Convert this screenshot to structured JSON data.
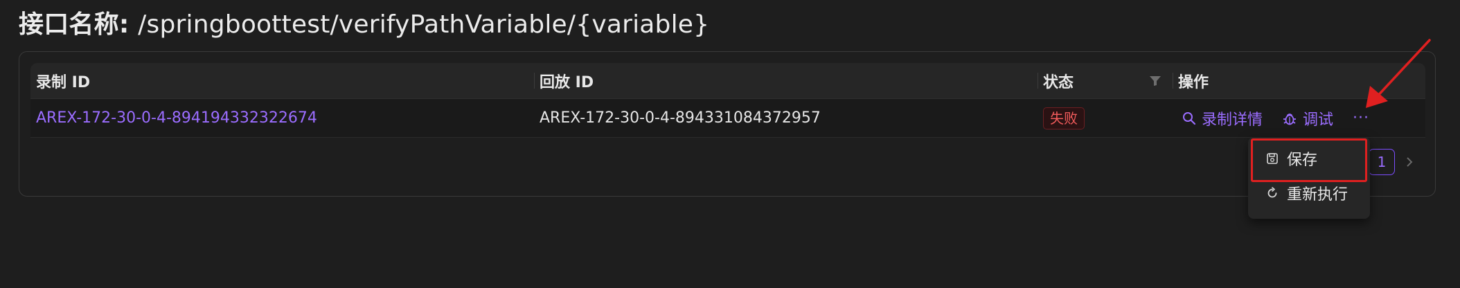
{
  "header": {
    "title_label": "接口名称",
    "title_colon": ": ",
    "title_path": "/springboottest/verifyPathVariable/{variable}"
  },
  "table": {
    "columns": {
      "record_id": "录制 ID",
      "replay_id": "回放 ID",
      "status": "状态",
      "actions": "操作"
    },
    "rows": [
      {
        "record_id": "AREX-172-30-0-4-894194332322674",
        "replay_id": "AREX-172-30-0-4-894331084372957",
        "status": "失败",
        "action_detail": "录制详情",
        "action_debug": "调试",
        "action_more": "···"
      }
    ]
  },
  "pagination": {
    "current_page": "1"
  },
  "dropdown": {
    "items": [
      {
        "label": "保存",
        "icon": "save-icon"
      },
      {
        "label": "重新执行",
        "icon": "reload-icon"
      }
    ]
  },
  "colors": {
    "accent": "#9b6dff",
    "error": "#f15b5b",
    "highlight": "#e02020",
    "background": "#1e1e1e"
  }
}
